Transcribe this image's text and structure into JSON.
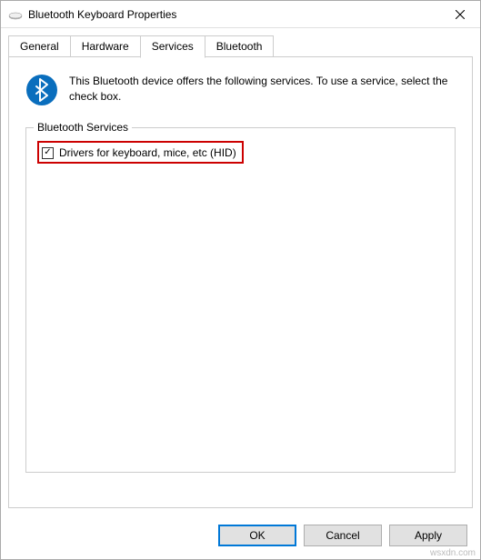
{
  "titlebar": {
    "title": "Bluetooth Keyboard Properties"
  },
  "tabs": {
    "general": "General",
    "hardware": "Hardware",
    "services": "Services",
    "bluetooth": "Bluetooth"
  },
  "content": {
    "intro": "This Bluetooth device offers the following services. To use a service, select the check box.",
    "fieldset_legend": "Bluetooth Services",
    "checkbox_label": "Drivers for keyboard, mice, etc (HID)",
    "checkbox_checked": "✓"
  },
  "buttons": {
    "ok": "OK",
    "cancel": "Cancel",
    "apply": "Apply"
  },
  "watermark": "wsxdn.com"
}
